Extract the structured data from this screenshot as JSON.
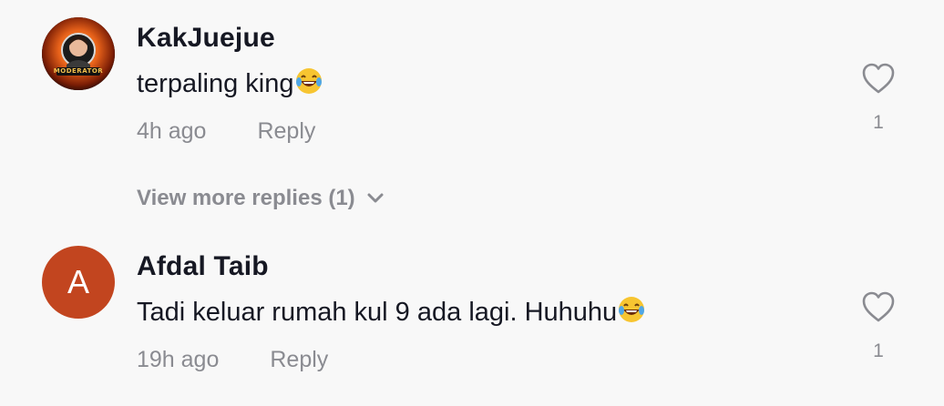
{
  "comments": [
    {
      "username": "KakJuejue",
      "text": "terpaling king",
      "emoji": "laughing-tears-emoji",
      "time": "4h ago",
      "reply_label": "Reply",
      "likes": "1",
      "avatar_badge": "MODERATOR"
    },
    {
      "username": "Afdal Taib",
      "text": "Tadi keluar rumah kul 9 ada lagi. Huhuhu",
      "emoji": "laughing-tears-emoji",
      "time": "19h ago",
      "reply_label": "Reply",
      "likes": "1",
      "avatar_letter": "A"
    }
  ],
  "view_more": {
    "label": "View more replies (1)"
  },
  "colors": {
    "background": "#f8f8f8",
    "primary_text": "#161823",
    "secondary_text": "#8a8b91",
    "avatar_letter_bg": "#c2451f"
  }
}
